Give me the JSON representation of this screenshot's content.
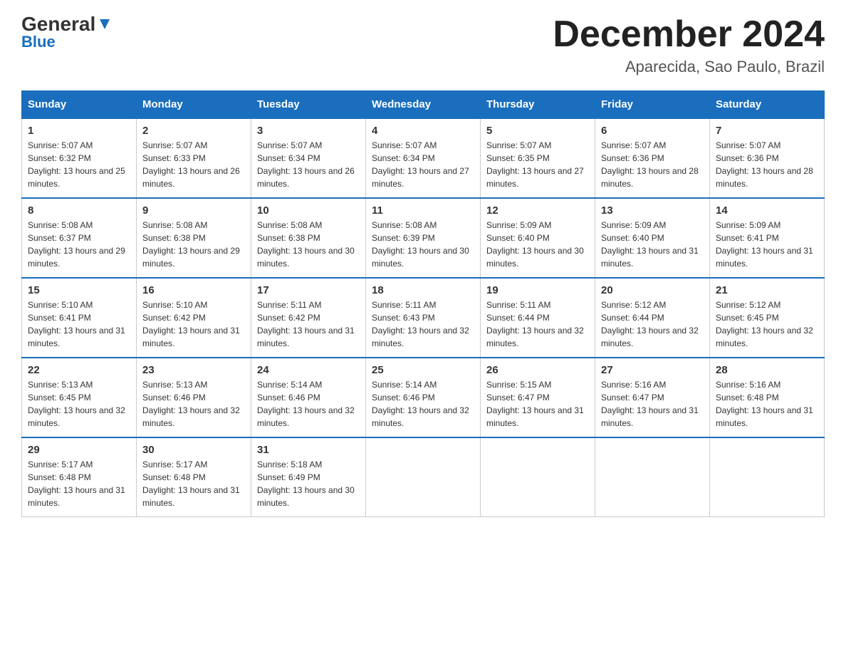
{
  "logo": {
    "part1": "General",
    "part2": "Blue"
  },
  "title": "December 2024",
  "subtitle": "Aparecida, Sao Paulo, Brazil",
  "headers": [
    "Sunday",
    "Monday",
    "Tuesday",
    "Wednesday",
    "Thursday",
    "Friday",
    "Saturday"
  ],
  "weeks": [
    [
      {
        "day": "1",
        "sunrise": "5:07 AM",
        "sunset": "6:32 PM",
        "daylight": "13 hours and 25 minutes."
      },
      {
        "day": "2",
        "sunrise": "5:07 AM",
        "sunset": "6:33 PM",
        "daylight": "13 hours and 26 minutes."
      },
      {
        "day": "3",
        "sunrise": "5:07 AM",
        "sunset": "6:34 PM",
        "daylight": "13 hours and 26 minutes."
      },
      {
        "day": "4",
        "sunrise": "5:07 AM",
        "sunset": "6:34 PM",
        "daylight": "13 hours and 27 minutes."
      },
      {
        "day": "5",
        "sunrise": "5:07 AM",
        "sunset": "6:35 PM",
        "daylight": "13 hours and 27 minutes."
      },
      {
        "day": "6",
        "sunrise": "5:07 AM",
        "sunset": "6:36 PM",
        "daylight": "13 hours and 28 minutes."
      },
      {
        "day": "7",
        "sunrise": "5:07 AM",
        "sunset": "6:36 PM",
        "daylight": "13 hours and 28 minutes."
      }
    ],
    [
      {
        "day": "8",
        "sunrise": "5:08 AM",
        "sunset": "6:37 PM",
        "daylight": "13 hours and 29 minutes."
      },
      {
        "day": "9",
        "sunrise": "5:08 AM",
        "sunset": "6:38 PM",
        "daylight": "13 hours and 29 minutes."
      },
      {
        "day": "10",
        "sunrise": "5:08 AM",
        "sunset": "6:38 PM",
        "daylight": "13 hours and 30 minutes."
      },
      {
        "day": "11",
        "sunrise": "5:08 AM",
        "sunset": "6:39 PM",
        "daylight": "13 hours and 30 minutes."
      },
      {
        "day": "12",
        "sunrise": "5:09 AM",
        "sunset": "6:40 PM",
        "daylight": "13 hours and 30 minutes."
      },
      {
        "day": "13",
        "sunrise": "5:09 AM",
        "sunset": "6:40 PM",
        "daylight": "13 hours and 31 minutes."
      },
      {
        "day": "14",
        "sunrise": "5:09 AM",
        "sunset": "6:41 PM",
        "daylight": "13 hours and 31 minutes."
      }
    ],
    [
      {
        "day": "15",
        "sunrise": "5:10 AM",
        "sunset": "6:41 PM",
        "daylight": "13 hours and 31 minutes."
      },
      {
        "day": "16",
        "sunrise": "5:10 AM",
        "sunset": "6:42 PM",
        "daylight": "13 hours and 31 minutes."
      },
      {
        "day": "17",
        "sunrise": "5:11 AM",
        "sunset": "6:42 PM",
        "daylight": "13 hours and 31 minutes."
      },
      {
        "day": "18",
        "sunrise": "5:11 AM",
        "sunset": "6:43 PM",
        "daylight": "13 hours and 32 minutes."
      },
      {
        "day": "19",
        "sunrise": "5:11 AM",
        "sunset": "6:44 PM",
        "daylight": "13 hours and 32 minutes."
      },
      {
        "day": "20",
        "sunrise": "5:12 AM",
        "sunset": "6:44 PM",
        "daylight": "13 hours and 32 minutes."
      },
      {
        "day": "21",
        "sunrise": "5:12 AM",
        "sunset": "6:45 PM",
        "daylight": "13 hours and 32 minutes."
      }
    ],
    [
      {
        "day": "22",
        "sunrise": "5:13 AM",
        "sunset": "6:45 PM",
        "daylight": "13 hours and 32 minutes."
      },
      {
        "day": "23",
        "sunrise": "5:13 AM",
        "sunset": "6:46 PM",
        "daylight": "13 hours and 32 minutes."
      },
      {
        "day": "24",
        "sunrise": "5:14 AM",
        "sunset": "6:46 PM",
        "daylight": "13 hours and 32 minutes."
      },
      {
        "day": "25",
        "sunrise": "5:14 AM",
        "sunset": "6:46 PM",
        "daylight": "13 hours and 32 minutes."
      },
      {
        "day": "26",
        "sunrise": "5:15 AM",
        "sunset": "6:47 PM",
        "daylight": "13 hours and 31 minutes."
      },
      {
        "day": "27",
        "sunrise": "5:16 AM",
        "sunset": "6:47 PM",
        "daylight": "13 hours and 31 minutes."
      },
      {
        "day": "28",
        "sunrise": "5:16 AM",
        "sunset": "6:48 PM",
        "daylight": "13 hours and 31 minutes."
      }
    ],
    [
      {
        "day": "29",
        "sunrise": "5:17 AM",
        "sunset": "6:48 PM",
        "daylight": "13 hours and 31 minutes."
      },
      {
        "day": "30",
        "sunrise": "5:17 AM",
        "sunset": "6:48 PM",
        "daylight": "13 hours and 31 minutes."
      },
      {
        "day": "31",
        "sunrise": "5:18 AM",
        "sunset": "6:49 PM",
        "daylight": "13 hours and 30 minutes."
      },
      null,
      null,
      null,
      null
    ]
  ],
  "labels": {
    "sunrise": "Sunrise:",
    "sunset": "Sunset:",
    "daylight": "Daylight:"
  }
}
